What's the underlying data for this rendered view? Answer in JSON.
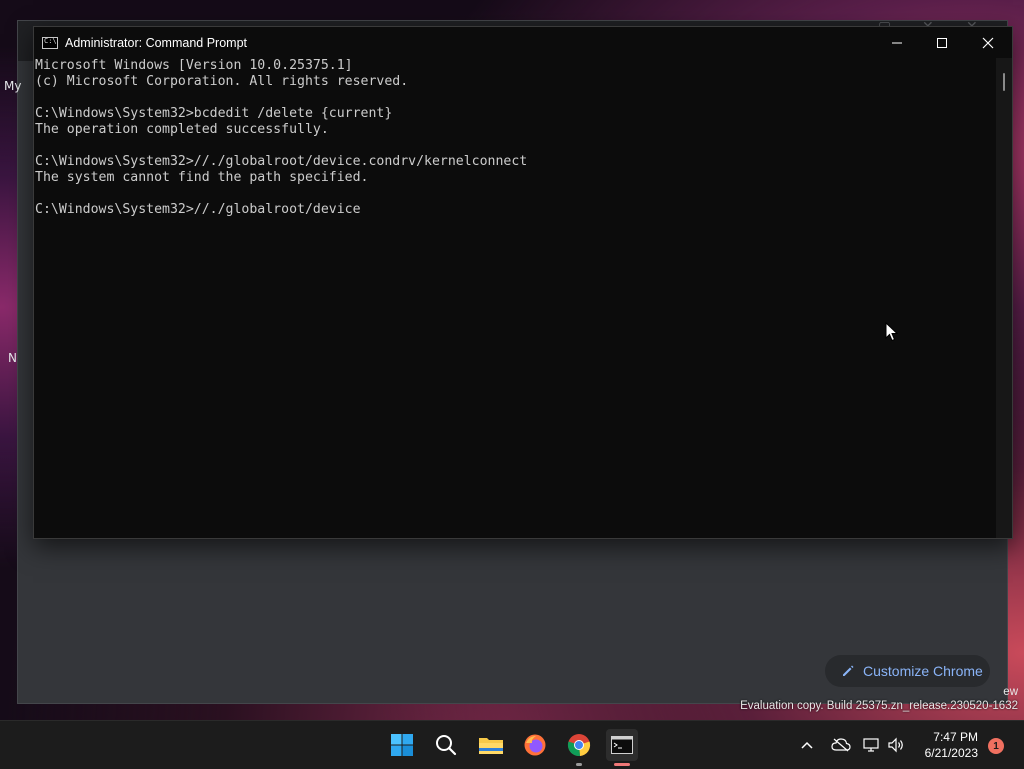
{
  "background_window": {
    "left_fragment": "My",
    "left_fragment_2": "N",
    "customize_label": "Customize Chrome",
    "watermark_tail": "ew",
    "watermark": "Evaluation copy. Build 25375.zn_release.230520-1632"
  },
  "console_window": {
    "title": "Administrator: Command Prompt",
    "icon_glyph": "C:\\",
    "lines": [
      "Microsoft Windows [Version 10.0.25375.1]",
      "(c) Microsoft Corporation. All rights reserved.",
      "",
      "C:\\Windows\\System32>bcdedit /delete {current}",
      "The operation completed successfully.",
      "",
      "C:\\Windows\\System32>//./globalroot/device.condrv/kernelconnect",
      "The system cannot find the path specified.",
      "",
      "C:\\Windows\\System32>//./globalroot/device"
    ],
    "controls": {
      "minimize": "minimize",
      "maximize": "maximize",
      "close": "close"
    }
  },
  "taskbar": {
    "apps": [
      "start",
      "search",
      "file-explorer",
      "firefox",
      "chrome",
      "terminal"
    ],
    "clock_time": "7:47 PM",
    "clock_date": "6/21/2023",
    "notification_count": "1"
  },
  "colors": {
    "console_bg": "#0c0c0c",
    "console_text": "#cccccc",
    "taskbar_bg": "#1c1c1c",
    "accent_blue": "#8ab4f8",
    "notification": "#f07060"
  }
}
